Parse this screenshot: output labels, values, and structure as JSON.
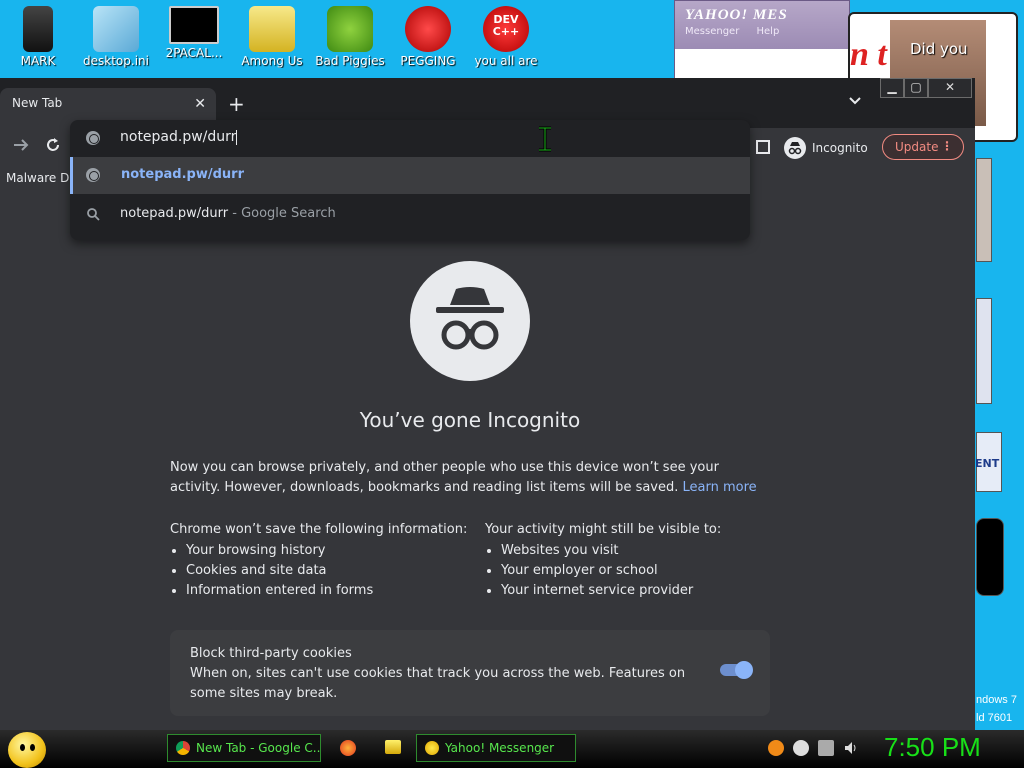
{
  "desktop": {
    "icons": [
      {
        "label": "MARK"
      },
      {
        "label": "desktop.ini"
      },
      {
        "label": "2PACAL..."
      },
      {
        "label": "Among Us"
      },
      {
        "label": "Bad Piggies"
      },
      {
        "label": "PEGGING"
      },
      {
        "label": "you all are"
      }
    ],
    "dev_icon_text": "DEV C++",
    "windows_text": "ndows 7",
    "build_text": "ld 7601",
    "partial_text": "ENT"
  },
  "yahoo_window": {
    "title": "YAHOO! MES",
    "menu": [
      "Messenger",
      "Help"
    ]
  },
  "poster": {
    "red_text": "n t",
    "caption": "Did you"
  },
  "browser": {
    "tab_title": "New Tab",
    "new_tab_symbol": "+",
    "close_symbol": "✕",
    "window_controls": [
      "▁",
      "▢",
      "✕"
    ],
    "toolbar": {
      "incognito_label": "Incognito",
      "update_label": "Update"
    },
    "bookmarks": [
      "Malware Da"
    ],
    "omnibox": {
      "typed_text": "notepad.pw/durr",
      "suggestions": [
        {
          "text": "notepad.pw/durr",
          "suffix": "",
          "type": "url",
          "selected": true
        },
        {
          "text": "notepad.pw/durr",
          "suffix": " - Google Search",
          "type": "search",
          "selected": false
        }
      ]
    },
    "page": {
      "heading": "You’ve gone Incognito",
      "intro": "Now you can browse privately, and other people who use this device won’t see your activity. However, downloads, bookmarks and reading list items will be saved.",
      "learn_more": "Learn more",
      "left_col": {
        "title": "Chrome won’t save the following information:",
        "items": [
          "Your browsing history",
          "Cookies and site data",
          "Information entered in forms"
        ]
      },
      "right_col": {
        "title": "Your activity might still be visible to:",
        "items": [
          "Websites you visit",
          "Your employer or school",
          "Your internet service provider"
        ]
      },
      "cookies_card": {
        "title": "Block third-party cookies",
        "body": "When on, sites can't use cookies that track you across the web. Features on some sites may break.",
        "toggle_on": true
      }
    }
  },
  "taskbar": {
    "buttons": [
      {
        "label": "New Tab - Google C..."
      },
      {
        "label": "Yahoo! Messenger"
      }
    ],
    "clock": "7:50 PM"
  },
  "colors": {
    "desktop": "#18b5ee",
    "chrome_bg": "#35363a",
    "accent_blue": "#8ab4f8",
    "update_red": "#f28b82",
    "clock_green": "#18e018"
  }
}
